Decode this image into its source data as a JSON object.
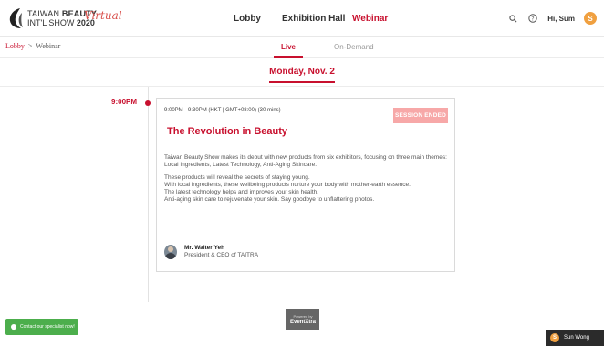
{
  "header": {
    "logo": {
      "line1_prefix": "TAIWAN ",
      "line1_bold": "BEAUTY",
      "line2_prefix": "INT'L SHOW ",
      "line2_bold": "2020",
      "virtual": "Virtual"
    },
    "nav": {
      "lobby": "Lobby",
      "exhibition": "Exhibition Hall",
      "webinar": "Webinar"
    },
    "greeting": "Hi, Sum",
    "avatar_initial": "S",
    "icons": [
      "search-icon",
      "help-icon"
    ]
  },
  "breadcrumb": {
    "lobby": "Lobby",
    "separator": ">",
    "current": "Webinar"
  },
  "tabs": {
    "live": "Live",
    "on_demand": "On-Demand"
  },
  "date": "Monday, Nov. 2",
  "timeline": {
    "time": "9:00PM"
  },
  "session": {
    "time_range": "9:00PM - 9:30PM (HKT | GMT+08:00) (30 mins)",
    "status": "SESSION ENDED",
    "title": "The Revolution in Beauty",
    "desc1": "Taiwan Beauty Show makes its debut with new products from six exhibitors, focusing on three main themes: Local Ingredients, Latest Technology, Anti-Aging Skincare.",
    "desc2": "These products will reveal the secrets of staying young.",
    "desc3": "With local ingredients, these wellbeing products nurture your body with mother-earth essence.",
    "desc4": "The latest technology helps and improves your skin health.",
    "desc5": "Anti-aging skin care to rejuvenate your skin. Say goodbye to unflattering photos.",
    "speaker": {
      "name": "Mr. Walter Yeh",
      "role": "President & CEO of TAITRA"
    }
  },
  "footer": {
    "powered_by": "Powered by",
    "brand": "EventXtra",
    "contact": "Contact our specialist now!",
    "chat_user": "Sun Wong",
    "chat_initial": "S"
  },
  "colors": {
    "accent": "#c8102e",
    "badge_ended": "#f7a8a8",
    "contact_green": "#4cae4c"
  }
}
